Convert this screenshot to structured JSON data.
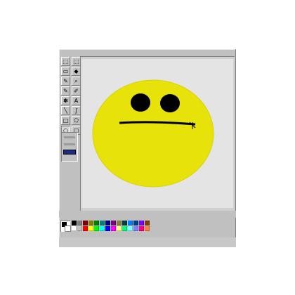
{
  "app": "Paint",
  "tools": [
    {
      "name": "free-select",
      "glyph": "⬚"
    },
    {
      "name": "rect-select",
      "glyph": "⬚"
    },
    {
      "name": "eraser",
      "glyph": "▭"
    },
    {
      "name": "fill",
      "glyph": "◆"
    },
    {
      "name": "pick-color",
      "glyph": "✎"
    },
    {
      "name": "magnifier",
      "glyph": "⌕"
    },
    {
      "name": "pencil",
      "glyph": "✎"
    },
    {
      "name": "brush",
      "glyph": "✐"
    },
    {
      "name": "airbrush",
      "glyph": "✽"
    },
    {
      "name": "text",
      "glyph": "A"
    },
    {
      "name": "line",
      "glyph": "╲"
    },
    {
      "name": "curve",
      "glyph": "∫"
    },
    {
      "name": "rectangle",
      "glyph": "□"
    },
    {
      "name": "polygon",
      "glyph": "⬠"
    },
    {
      "name": "ellipse",
      "glyph": "○"
    },
    {
      "name": "rounded-rect",
      "glyph": "▢"
    }
  ],
  "active_tool": "ellipse",
  "colors": {
    "face": "#e6e20a",
    "face_edge": "#d9d300",
    "feature": "#000000",
    "canvas": "#e4e4e4"
  },
  "palette_top": [
    "#000000",
    "#808080",
    "#800000",
    "#808000",
    "#008000",
    "#008080",
    "#000080",
    "#800080",
    "#808040",
    "#004040",
    "#0080ff",
    "#004080",
    "#8000ff",
    "#804000"
  ],
  "palette_bottom": [
    "#ffffff",
    "#c0c0c0",
    "#ff0000",
    "#ffff00",
    "#00ff00",
    "#00ffff",
    "#0000ff",
    "#ff00ff",
    "#ffff80",
    "#00ff80",
    "#80ffff",
    "#8080ff",
    "#ff0080",
    "#ff8040"
  ]
}
